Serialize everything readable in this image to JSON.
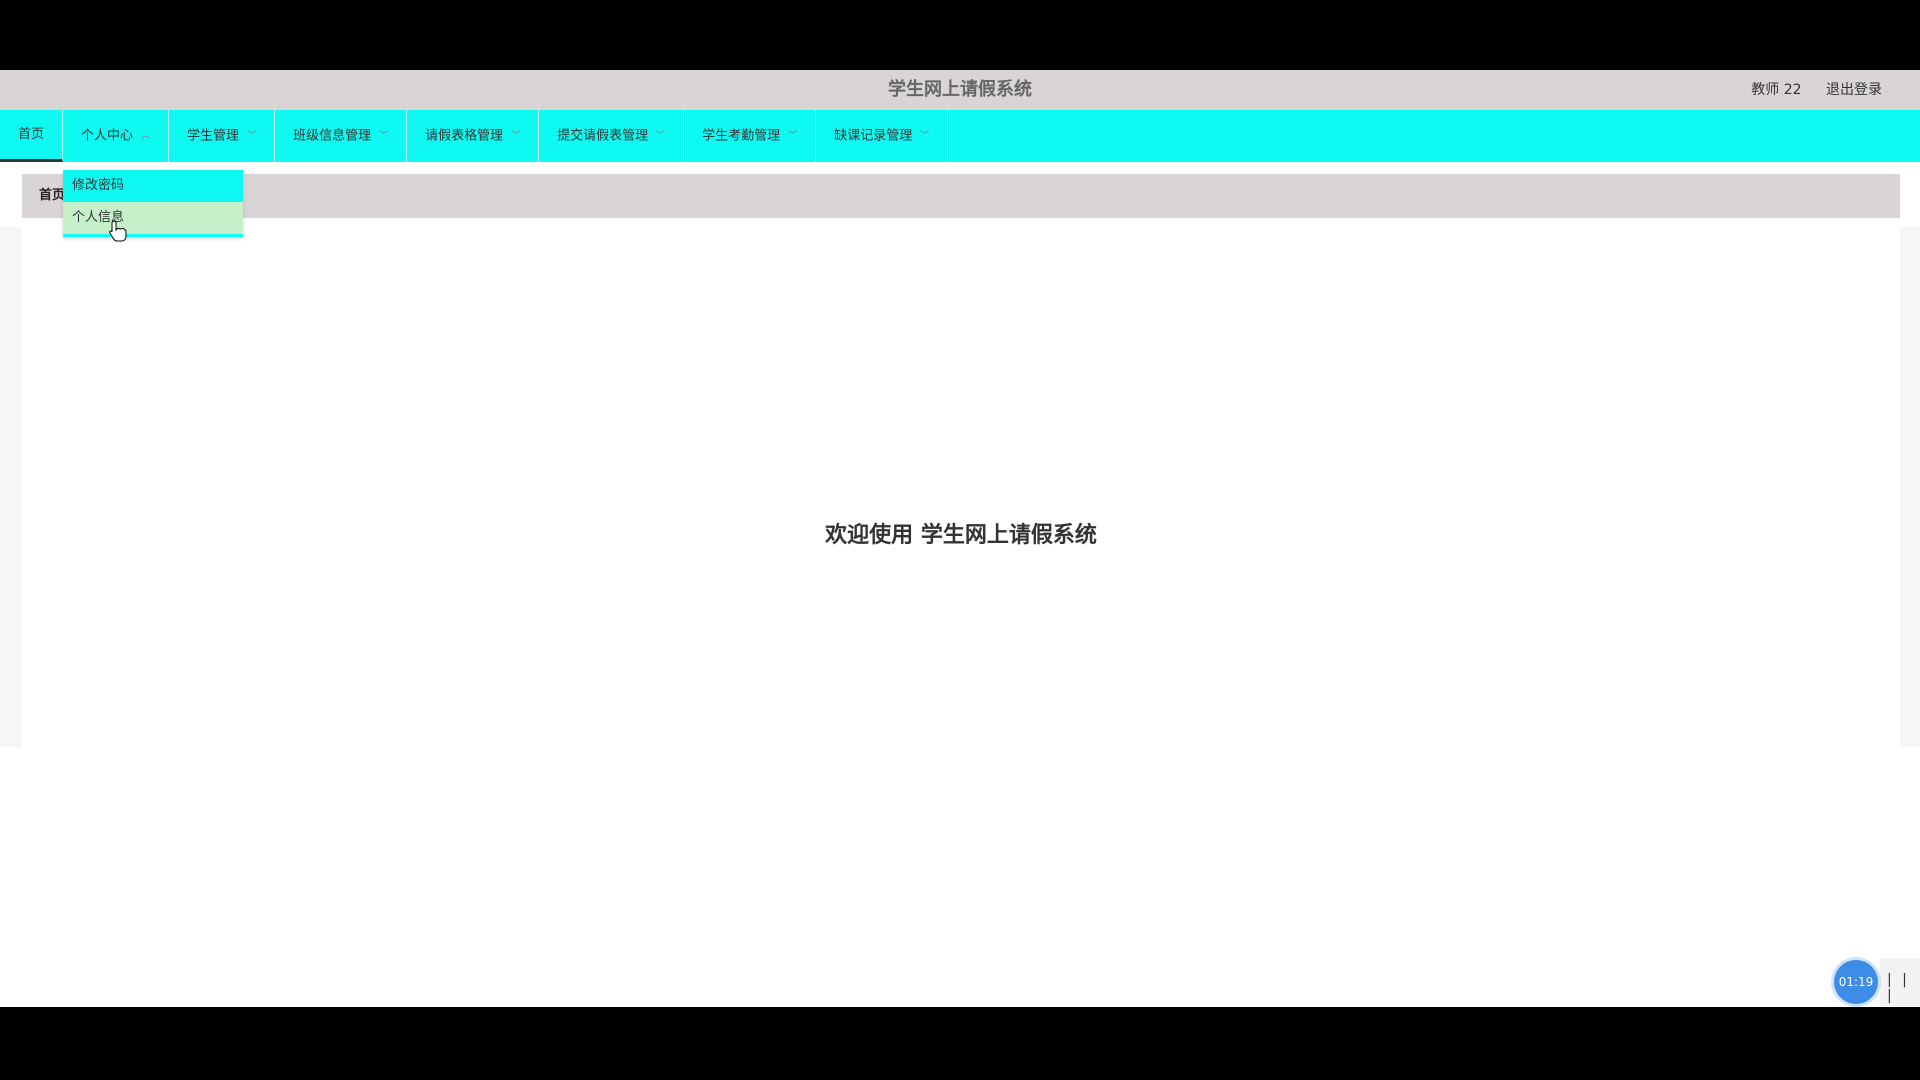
{
  "header": {
    "app_title": "学生网上请假系统",
    "user": "教师 22",
    "logout": "退出登录"
  },
  "nav": {
    "items": [
      {
        "label": "首页"
      },
      {
        "label": "个人中心"
      },
      {
        "label": "学生管理"
      },
      {
        "label": "班级信息管理"
      },
      {
        "label": "请假表格管理"
      },
      {
        "label": "提交请假表管理"
      },
      {
        "label": "学生考勤管理"
      },
      {
        "label": "缺课记录管理"
      }
    ]
  },
  "dropdown": {
    "items": [
      {
        "label": "修改密码"
      },
      {
        "label": "个人信息"
      }
    ]
  },
  "breadcrumb": "首页",
  "main": {
    "welcome": "欢迎使用 学生网上请假系统"
  },
  "recorder": {
    "time": "01:19"
  },
  "colors": {
    "nav_bg": "#0ef9f1",
    "header_bg": "#dad5d5",
    "dropdown_hover": "#c5f0c9",
    "timer_bg": "#3d8ce8"
  }
}
